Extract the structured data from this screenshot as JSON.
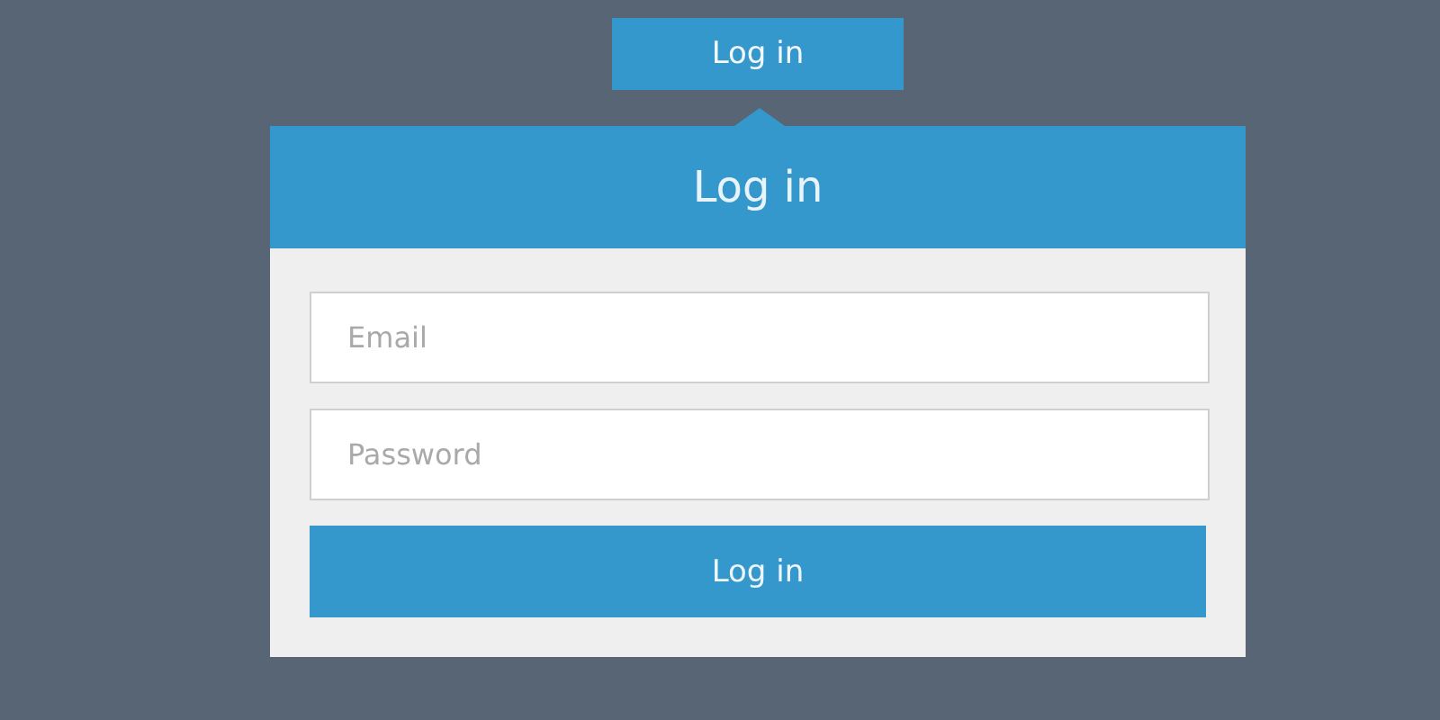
{
  "top_button": {
    "label": "Log in"
  },
  "panel": {
    "title": "Log in",
    "fields": [
      {
        "placeholder": "Email"
      },
      {
        "placeholder": "Password"
      }
    ],
    "submit": {
      "label": "Log in"
    }
  }
}
